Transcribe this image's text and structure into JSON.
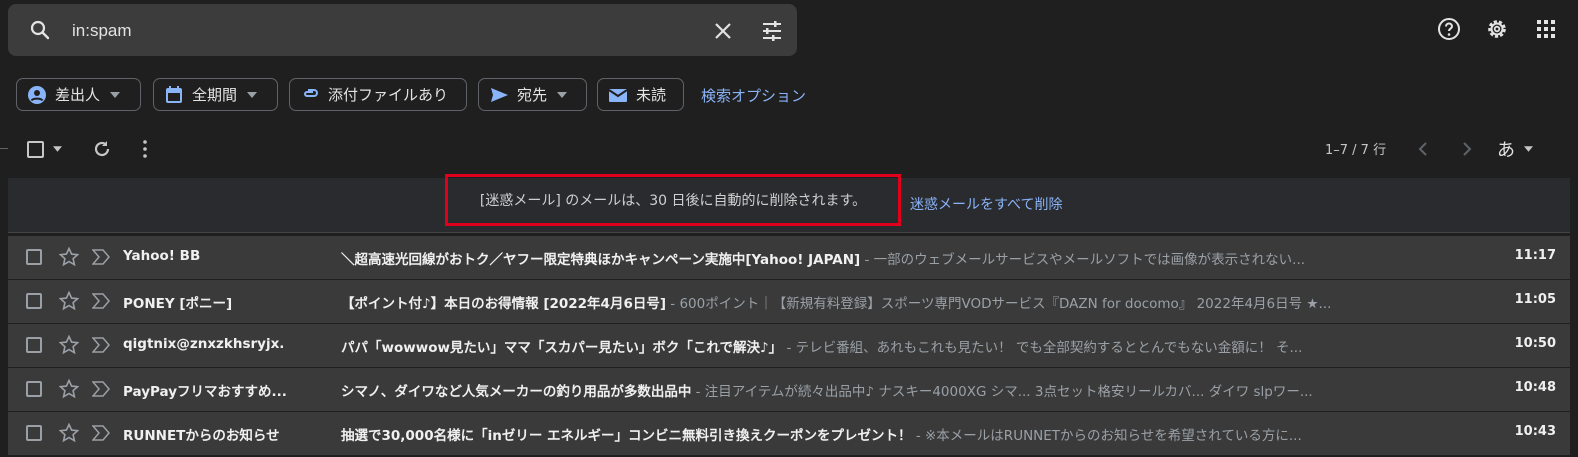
{
  "search": {
    "query": "in:spam"
  },
  "chips": [
    {
      "label": "差出人"
    },
    {
      "label": "全期間"
    },
    {
      "label": "添付ファイルあり"
    },
    {
      "label": "宛先"
    },
    {
      "label": "未読"
    }
  ],
  "advanced_search_link": "検索オプション",
  "toolbar": {
    "count": "1–7 / 7 行",
    "input_tool": "あ"
  },
  "banner": {
    "message": "[迷惑メール] のメールは、30 日後に自動的に削除されます。",
    "link": "迷惑メールをすべて削除"
  },
  "emails": [
    {
      "sender": "Yahoo! BB",
      "subject": "＼超高速光回線がおトク／ヤフー限定特典ほかキャンペーン実施中[Yahoo! JAPAN]",
      "snippet": " - 一部のウェブメールサービスやメールソフトでは画像が表示されない...",
      "time": "11:17"
    },
    {
      "sender": "PONEY [ポニー]",
      "subject": "【ポイント付♪】本日のお得情報 [2022年4月6日号]",
      "snippet": " - 600ポイント｜【新規有料登録】スポーツ専門VODサービス『DAZN for docomo』 2022年4月6日号 ★...",
      "time": "11:05"
    },
    {
      "sender": "qigtnix@znxzkhsryjx.",
      "subject": "パパ「wowwow見たい」ママ「スカパー見たい」ボク「これで解決♪」",
      "snippet": " - テレビ番組、あれもこれも見たい！ でも全部契約するととんでもない金額に！ そ...",
      "time": "10:50"
    },
    {
      "sender": "PayPayフリマおすすめ...",
      "subject": "シマノ、ダイワなど人気メーカーの釣り用品が多数出品中",
      "snippet": " - 注目アイテムが続々出品中♪ ナスキー4000XG シマ... 3点セット格安リールカバ... ダイワ slpワー...",
      "time": "10:48"
    },
    {
      "sender": "RUNNETからのお知らせ",
      "subject": "抽選で30,000名様に「inゼリー エネルギー」コンビニ無料引き換えクーポンをプレゼント！",
      "snippet": " - ※本メールはRUNNETからのお知らせを希望されている方に...",
      "time": "10:43"
    }
  ]
}
